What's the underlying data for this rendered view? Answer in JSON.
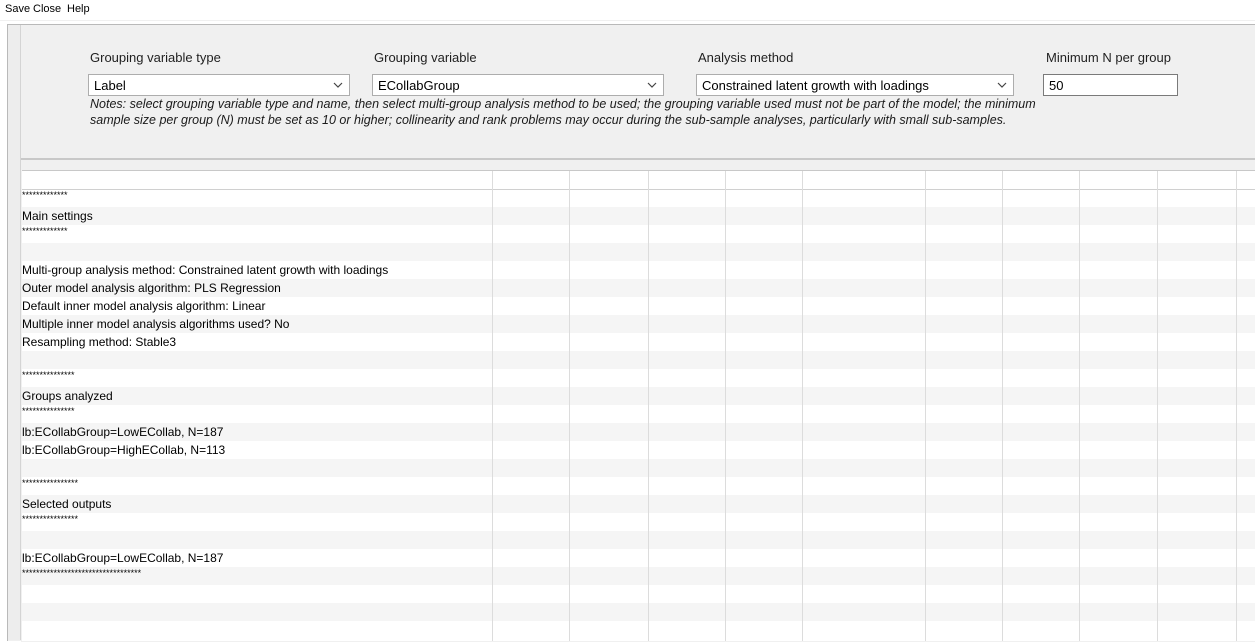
{
  "menu": {
    "items": [
      "Save",
      "Close",
      "Help"
    ]
  },
  "settings": {
    "grouping_type_label": "Grouping variable type",
    "grouping_type_value": "Label",
    "grouping_variable_label": "Grouping variable",
    "grouping_variable_value": "ECollabGroup",
    "analysis_method_label": "Analysis method",
    "analysis_method_value": "Constrained latent growth with loadings",
    "min_n_label": "Minimum N per group",
    "min_n_value": "50",
    "notes_line1": "Notes: select grouping variable type and name, then select multi-group analysis method to be used; the grouping variable used must not be part of the model; the minimum",
    "notes_line2": "sample size per group (N) must be set as 10 or higher; collinearity and rank problems may occur during the sub-sample analyses, particularly with small sub-samples."
  },
  "output_rows": [
    "*************",
    "Main settings",
    "*************",
    "",
    "Multi-group analysis method: Constrained latent growth with loadings",
    "Outer model analysis algorithm: PLS Regression",
    "Default inner model analysis algorithm: Linear",
    "Multiple inner model analysis algorithms used? No",
    "Resampling method: Stable3",
    "",
    "***************",
    "Groups analyzed",
    "***************",
    "lb:ECollabGroup=LowECollab, N=187",
    "lb:ECollabGroup=HighECollab, N=113",
    "",
    "****************",
    "Selected outputs",
    "****************",
    "",
    "lb:ECollabGroup=LowECollab, N=187",
    "**********************************",
    "",
    ""
  ]
}
